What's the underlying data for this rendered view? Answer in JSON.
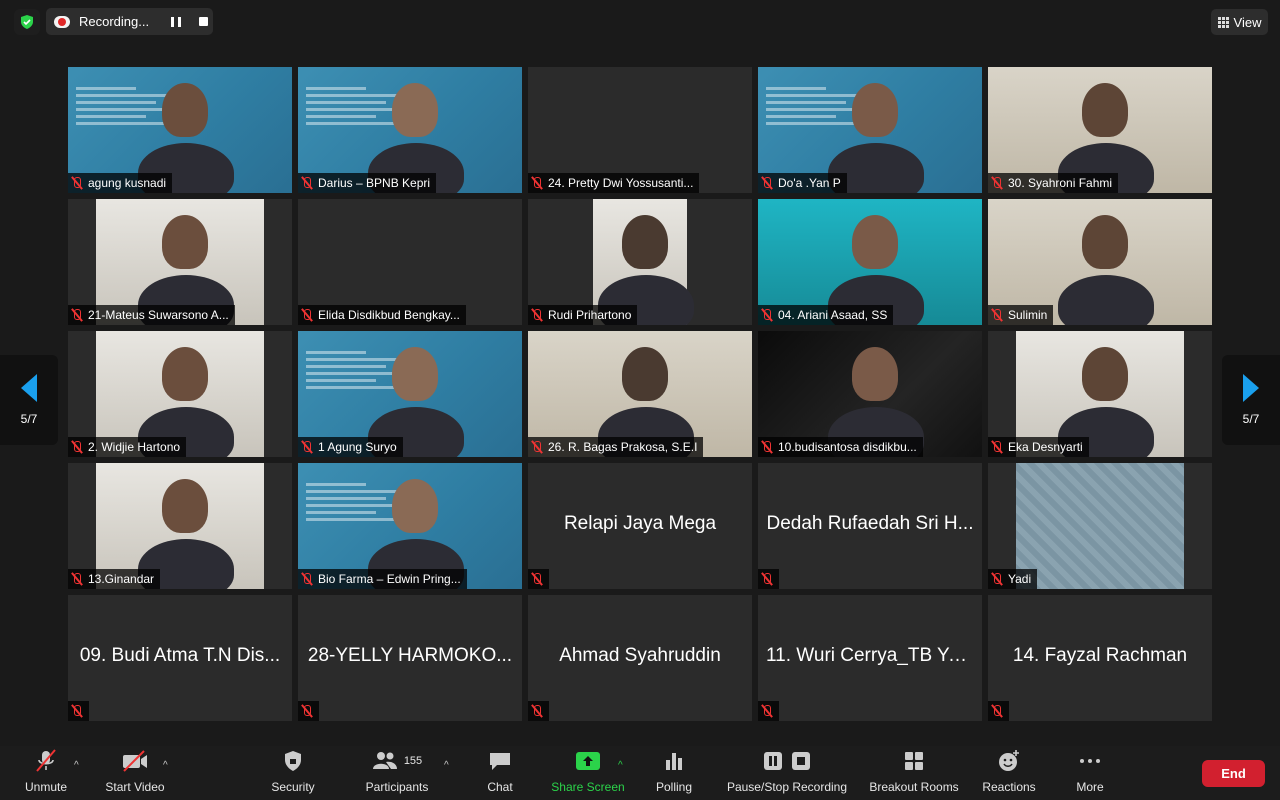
{
  "top": {
    "recording_label": "Recording...",
    "view_label": "View"
  },
  "pager": {
    "page": "5/7"
  },
  "tiles": [
    {
      "name": "agung kusnadi",
      "kind": "video",
      "bg": "slide"
    },
    {
      "name": "Darius – BPNB Kepri",
      "kind": "video",
      "bg": "slide"
    },
    {
      "name": "24. Pretty Dwi Yossusanti...",
      "kind": "video",
      "bg": "empty"
    },
    {
      "name": "Do'a .Yan P",
      "kind": "video",
      "bg": "slide"
    },
    {
      "name": "30. Syahroni Fahmi",
      "kind": "video",
      "bg": "room"
    },
    {
      "name": "21-Mateus Suwarsono A...",
      "kind": "video",
      "bg": "room2"
    },
    {
      "name": "Elida Disdikbud Bengkay...",
      "kind": "video",
      "bg": "empty"
    },
    {
      "name": "Rudi Prihartono",
      "kind": "video",
      "bg": "room2"
    },
    {
      "name": "04. Ariani Asaad, SS",
      "kind": "video",
      "bg": "teal"
    },
    {
      "name": "Sulimin",
      "kind": "video",
      "bg": "room"
    },
    {
      "name": "2. Widjie Hartono",
      "kind": "video",
      "bg": "room2"
    },
    {
      "name": "1 Agung Suryo",
      "kind": "video",
      "bg": "slide"
    },
    {
      "name": "26. R. Bagas Prakosa, S.E.I",
      "kind": "video",
      "bg": "room"
    },
    {
      "name": "10.budisantosa disdikbu...",
      "kind": "video",
      "bg": "dark"
    },
    {
      "name": "Eka Desnyarti",
      "kind": "video",
      "bg": "room2"
    },
    {
      "name": "13.Ginandar",
      "kind": "video",
      "bg": "room2"
    },
    {
      "name": "Bio Farma – Edwin Pring...",
      "kind": "video",
      "bg": "slide"
    },
    {
      "name": "Relapi Jaya Mega",
      "kind": "name",
      "bg": "empty"
    },
    {
      "name": "Dedah Rufaedah Sri H...",
      "kind": "name",
      "bg": "empty"
    },
    {
      "name": "Yadi",
      "kind": "video",
      "bg": "pattern"
    },
    {
      "name": "09. Budi Atma T.N Dis...",
      "kind": "name",
      "bg": "empty"
    },
    {
      "name": "28-YELLY HARMOKO...",
      "kind": "name",
      "bg": "empty"
    },
    {
      "name": "Ahmad Syahruddin",
      "kind": "name",
      "bg": "empty"
    },
    {
      "name": "11. Wuri Cerrya_TB Yo...",
      "kind": "name",
      "bg": "empty"
    },
    {
      "name": "14. Fayzal Rachman",
      "kind": "name",
      "bg": "empty"
    }
  ],
  "toolbar": {
    "unmute": "Unmute",
    "start_video": "Start Video",
    "security": "Security",
    "participants": "Participants",
    "participants_count": "155",
    "chat": "Chat",
    "share_screen": "Share Screen",
    "polling": "Polling",
    "pause_stop_recording": "Pause/Stop Recording",
    "breakout_rooms": "Breakout Rooms",
    "reactions": "Reactions",
    "more": "More",
    "end": "End"
  },
  "colors": {
    "share_green": "#2bd34a",
    "end_red": "#d2202f",
    "pager_blue": "#1aa0ee",
    "muted_red": "#e33333"
  }
}
